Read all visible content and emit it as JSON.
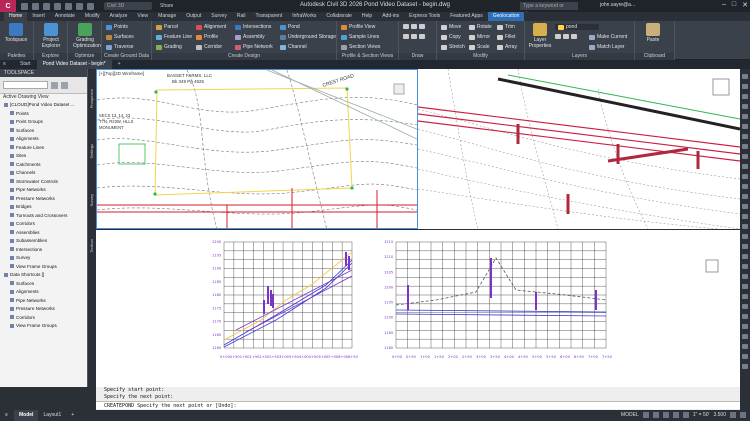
{
  "titlebar": {
    "logo": "C",
    "civil_search": "Civil 3D",
    "share": "Share",
    "title": "Autodesk Civil 3D 2026   Pond Video Dataset - begin.dwg",
    "help_search": "Type a keyword or phrase",
    "user": "john.sayre@a..."
  },
  "ribbon_tabs": [
    "Home",
    "Insert",
    "Annotate",
    "Modify",
    "Analyze",
    "View",
    "Manage",
    "Output",
    "Survey",
    "Rail",
    "Transparent",
    "InfraWorks",
    "Collaborate",
    "Help",
    "Add-ins",
    "Express Tools",
    "Featured Apps",
    "Geolocation"
  ],
  "ribbon": {
    "toolspace": "Toolspace",
    "project_explorer": "Project Explorer",
    "grading_optimization": "Grading Optimization",
    "points": "Points",
    "surfaces": "Surfaces",
    "traverse": "Traverse",
    "parcel": "Parcel",
    "feature_line": "Feature Line",
    "grading": "Grading",
    "alignment": "Alignment",
    "profile": "Profile",
    "corridor": "Corridor",
    "intersections": "Intersections",
    "assembly": "Assembly",
    "pipe_network": "Pipe Network",
    "pond": "Pond",
    "underground_storage": "Underground Storage",
    "channel": "Channel",
    "profile_view": "Profile View",
    "sample_lines": "Sample Lines",
    "section_views": "Section Views",
    "move": "Move",
    "rotate": "Rotate",
    "trim": "Trim",
    "copy": "Copy",
    "mirror": "Mirror",
    "fillet": "Fillet",
    "stretch": "Stretch",
    "scale": "Scale",
    "array": "Array",
    "layer_properties": "Layer Properties",
    "layer_name": "pond",
    "make_current": "Make Current",
    "match_layer": "Match Layer",
    "paste": "Paste",
    "groups": [
      "Palettes",
      "Explore",
      "Optimize",
      "Create Ground Data",
      "Create Design",
      "Profile & Section Views",
      "Draw",
      "Modify",
      "Layers",
      "Clipboard"
    ]
  },
  "file_tabs": [
    "Start",
    "Pond Video Dataset - begin*"
  ],
  "toolspace": {
    "header": "TOOLSPACE",
    "view": "Active Drawing View",
    "tree": [
      "[CLOUD]Pond Video Dataset ...",
      "Points",
      "Point Groups",
      "Surfaces",
      "Alignments",
      "Feature Lines",
      "Sites",
      "Catchments",
      "Channels",
      "Stormwater Controls",
      "Pipe Networks",
      "Pressure Networks",
      "Bridges",
      "Turnouts and Crossovers",
      "Corridors",
      "Assemblies",
      "Subassemblies",
      "Intersections",
      "Survey",
      "View Frame Groups",
      "Data Shortcuts []",
      "Surfaces",
      "Alignments",
      "Pipe Networks",
      "Pressure Networks",
      "Corridors",
      "View Frame Groups"
    ],
    "side_tabs": [
      "Prospector",
      "Settings",
      "Survey",
      "Toolbox"
    ]
  },
  "viewports": {
    "top_left_label": "[+][Top][2D Wireframe]",
    "annotation1": "BASSET FARMS, LLC",
    "annotation2": "Bk 349 Pg 4925",
    "annotation3": "SECS 13, 14, 23",
    "annotation4": "T7N, R23W, HLLS",
    "annotation5": "MONUMENT",
    "road_label": "CREST ROAD"
  },
  "profile_left": {
    "stations": [
      "0+00",
      "0+50",
      "1+00",
      "1+50",
      "2+00",
      "2+50",
      "3+00",
      "3+50",
      "4+00",
      "4+50",
      "5+00",
      "5+50",
      "6+00",
      "6+50"
    ],
    "elevations": [
      "1200",
      "1195",
      "1190",
      "1185",
      "1180",
      "1175",
      "1170",
      "1165",
      "1160"
    ]
  },
  "profile_right": {
    "stations": [
      "0+00",
      "0+50",
      "1+00",
      "1+50",
      "2+00",
      "2+50",
      "3+00",
      "3+50",
      "4+00",
      "4+50",
      "5+00",
      "5+50",
      "6+00",
      "6+50",
      "7+00",
      "7+50"
    ],
    "elevations": [
      "1215",
      "1210",
      "1205",
      "1200",
      "1195",
      "1190",
      "1185",
      "1180"
    ]
  },
  "command": {
    "line1": "Specify start point:",
    "line2": "Specify the next point:",
    "prompt": "CREATEPOND Specify the next point or [Undo]:"
  },
  "status": {
    "tabs": [
      "Model",
      "Layout1"
    ],
    "model_label": "MODEL",
    "scale": "1\" = 50'",
    "elevation": "3.500"
  },
  "colors": {
    "brand": "#b9275a",
    "geo_tab": "#2d6fb7",
    "profile_grid": "#333333",
    "pipe": "#cc2244",
    "alignment_red": "#d21d2b"
  }
}
